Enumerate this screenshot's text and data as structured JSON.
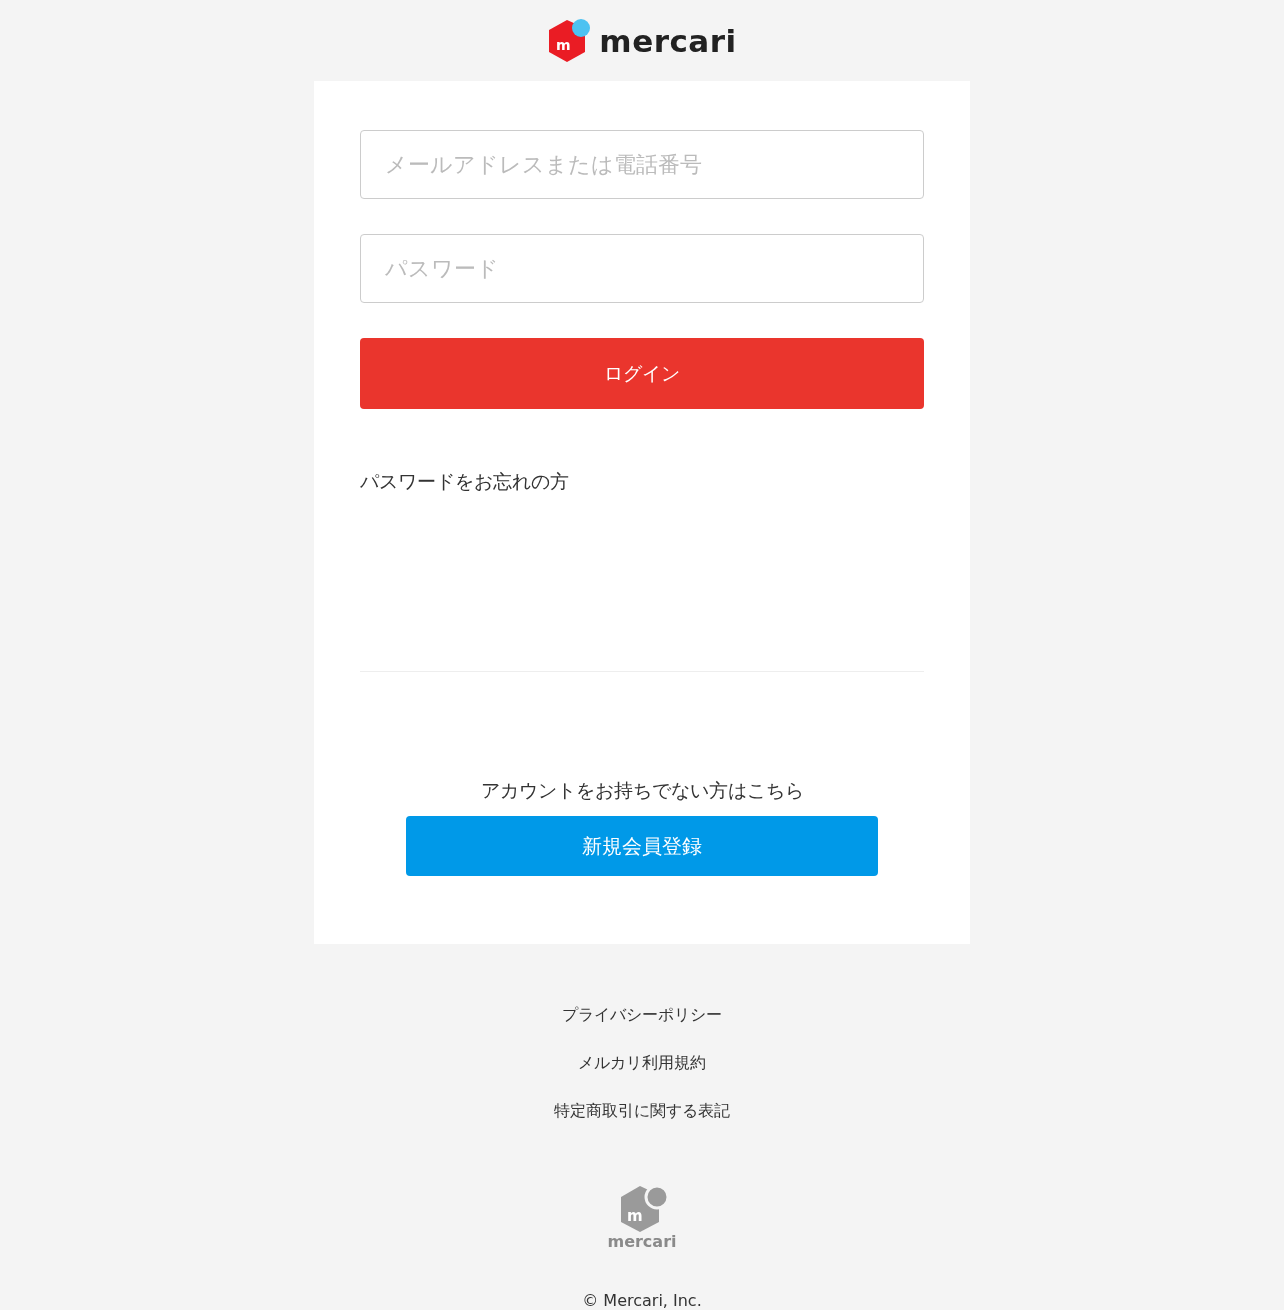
{
  "header": {
    "logo_mark": "m",
    "logo_text": "mercari"
  },
  "login_form": {
    "email": {
      "placeholder": "メールアドレスまたは電話番号"
    },
    "password": {
      "placeholder": "パスワード"
    },
    "login_button": "ログイン",
    "forgot_link": "パスワードをお忘れの方"
  },
  "signup": {
    "prompt": "アカウントをお持ちでない方はこちら",
    "button": "新規会員登録"
  },
  "footer": {
    "links": [
      "プライバシーポリシー",
      "メルカリ利用規約",
      "特定商取引に関する表記"
    ],
    "logo_mark": "m",
    "logo_text": "mercari",
    "copyright": "© Mercari, Inc."
  }
}
